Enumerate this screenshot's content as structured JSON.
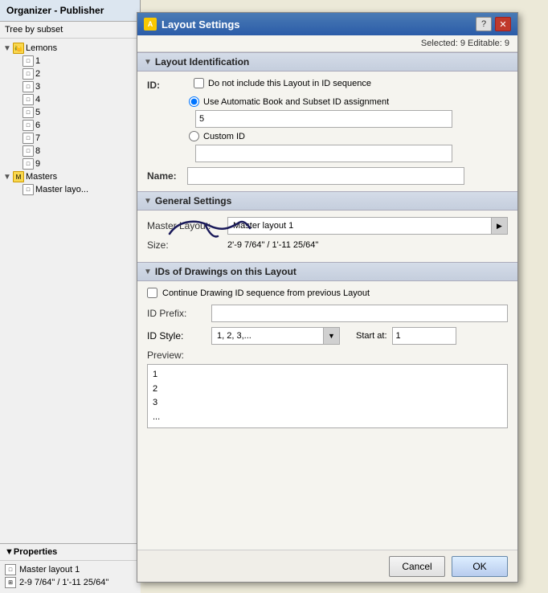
{
  "organizer": {
    "title": "Organizer - Publisher",
    "tree_dropdown": "Tree by subset",
    "tree": {
      "root": "Lemons",
      "items": [
        "1",
        "2",
        "3",
        "4",
        "5",
        "6",
        "7",
        "8",
        "9"
      ],
      "masters_label": "Masters",
      "master_layout_label": "Master layo..."
    },
    "properties": {
      "title": "Properties",
      "name": "Master layout 1",
      "size": "2-9 7/64\" / 1'-11 25/64\""
    }
  },
  "dialog": {
    "title": "Layout Settings",
    "selected_info": "Selected: 9  Editable: 9",
    "sections": {
      "layout_identification": {
        "label": "Layout Identification",
        "id_label": "ID:",
        "checkbox_no_include": "Do not include this Layout in ID sequence",
        "radio_auto": "Use Automatic Book and Subset ID assignment",
        "auto_value": "5",
        "radio_custom": "Custom ID",
        "custom_value": "",
        "name_label": "Name:",
        "name_value": ""
      },
      "general_settings": {
        "label": "General Settings",
        "master_layout_label": "Master Layout:",
        "master_layout_value": "Master layout 1",
        "size_label": "Size:",
        "size_value": "2'-9 7/64\" / 1'-11 25/64\""
      },
      "ids_of_drawings": {
        "label": "IDs of Drawings on this Layout",
        "checkbox_continue": "Continue Drawing ID sequence from previous Layout",
        "id_prefix_label": "ID Prefix:",
        "id_prefix_value": "",
        "id_style_label": "ID Style:",
        "id_style_value": "1, 2, 3,...",
        "start_at_label": "Start at:",
        "start_at_value": "1",
        "preview_label": "Preview:",
        "preview_lines": [
          "1",
          "2",
          "3",
          "..."
        ]
      }
    },
    "buttons": {
      "cancel": "Cancel",
      "ok": "OK"
    }
  }
}
